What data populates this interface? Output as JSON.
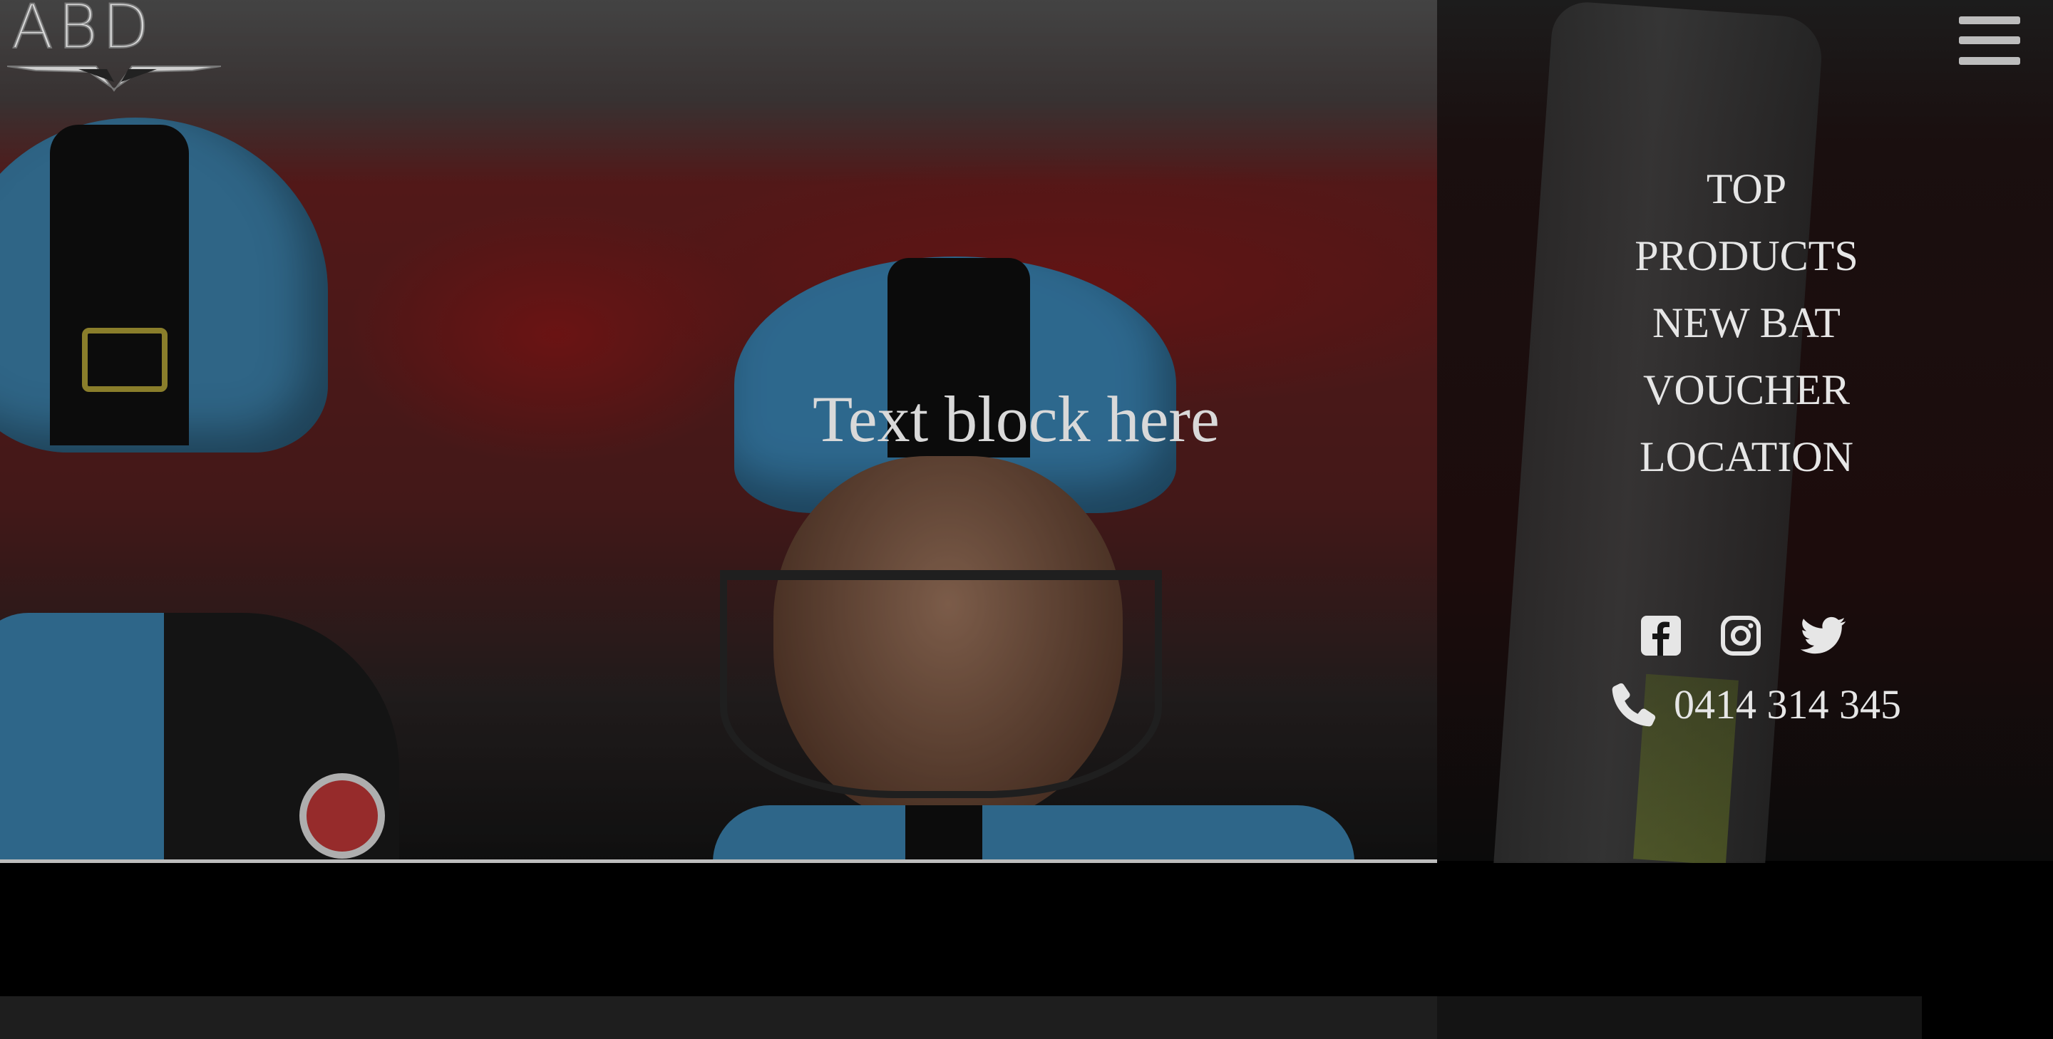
{
  "logo": {
    "text": "ABD"
  },
  "hero": {
    "text": "Text block here"
  },
  "nav": {
    "items": [
      {
        "label": "TOP"
      },
      {
        "label": "PRODUCTS"
      },
      {
        "label": "NEW BAT"
      },
      {
        "label": "VOUCHER"
      },
      {
        "label": "LOCATION"
      }
    ]
  },
  "social": {
    "icons": [
      "facebook-icon",
      "instagram-icon",
      "twitter-icon"
    ]
  },
  "contact": {
    "phone": "0414 314 345",
    "icon": "phone-icon"
  },
  "colors": {
    "nav_text": "#e6e6e6",
    "background": "#000000",
    "panel": "#1a1a1a"
  }
}
